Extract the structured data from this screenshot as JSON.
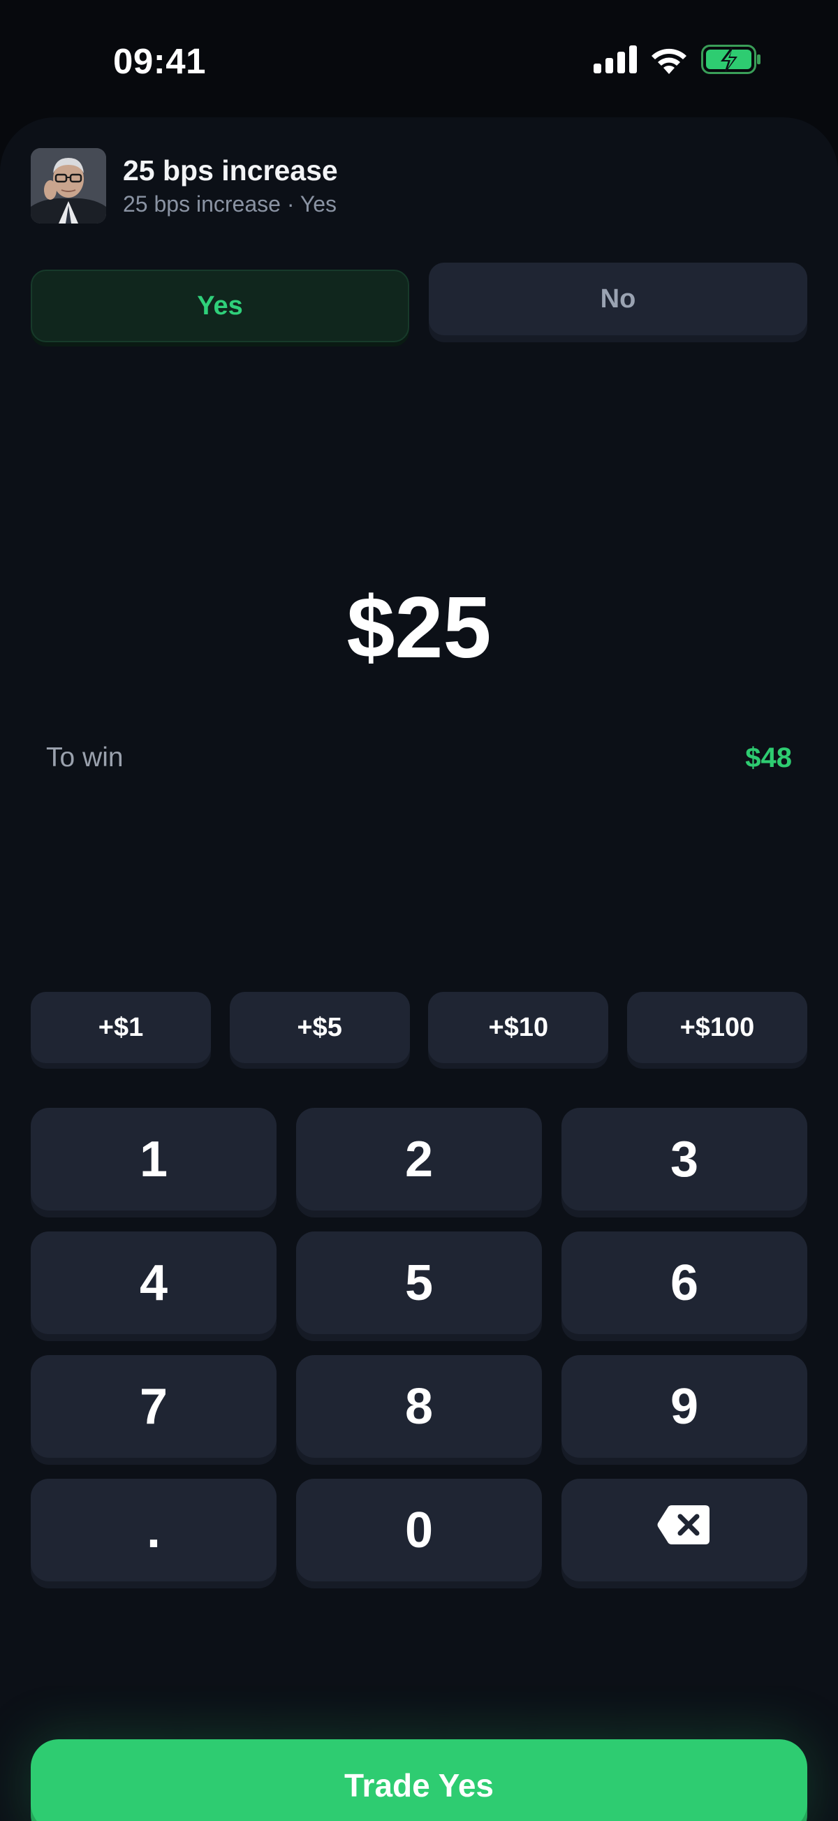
{
  "status_bar": {
    "time": "09:41"
  },
  "market": {
    "title": "25 bps increase",
    "subtitle": "25 bps increase · Yes"
  },
  "sides": {
    "yes_label": "Yes",
    "no_label": "No",
    "selected": "Yes"
  },
  "order": {
    "amount": "$25",
    "to_win_label": "To win",
    "to_win_value": "$48"
  },
  "quick_add": [
    {
      "label": "+$1"
    },
    {
      "label": "+$5"
    },
    {
      "label": "+$10"
    },
    {
      "label": "+$100"
    }
  ],
  "keypad": {
    "k1": "1",
    "k2": "2",
    "k3": "3",
    "k4": "4",
    "k5": "5",
    "k6": "6",
    "k7": "7",
    "k8": "8",
    "k9": "9",
    "dot": ".",
    "k0": "0",
    "backspace_icon": "backspace-icon"
  },
  "trade_button": {
    "label": "Trade Yes"
  },
  "colors": {
    "accent_green": "#2ecc71",
    "background": "#0c1017",
    "key_surface": "#1f2533"
  }
}
